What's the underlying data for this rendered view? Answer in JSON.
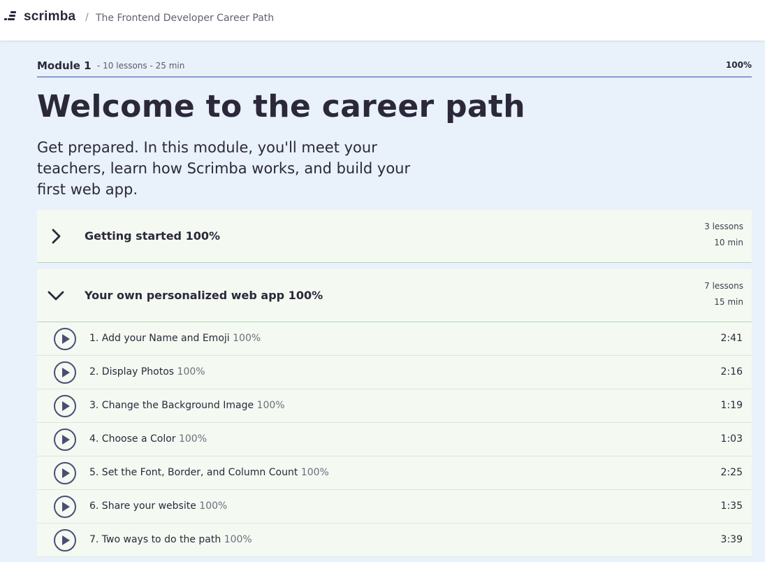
{
  "header": {
    "logo_text": "scrimba",
    "breadcrumb_separator": "/",
    "breadcrumb": "The Frontend Developer Career Path"
  },
  "module": {
    "title": "Module 1",
    "meta": "- 10 lessons - 25 min",
    "progress": "100%"
  },
  "hero": {
    "title": "Welcome to the career path",
    "description": "Get prepared. In this module, you'll meet your teachers, learn how Scrimba works, and build your first web app."
  },
  "sections": [
    {
      "title": "Getting started 100%",
      "lessons": "3 lessons",
      "duration": "10 min",
      "expanded": false,
      "icon": "chevron-right-icon"
    },
    {
      "title": "Your own personalized web app 100%",
      "lessons": "7 lessons",
      "duration": "15 min",
      "expanded": true,
      "icon": "chevron-down-icon"
    }
  ],
  "lessons": [
    {
      "title": "1. Add your Name and Emoji",
      "progress": "100%",
      "duration": "2:41"
    },
    {
      "title": "2. Display Photos",
      "progress": "100%",
      "duration": "2:16"
    },
    {
      "title": "3. Change the Background Image",
      "progress": "100%",
      "duration": "1:19"
    },
    {
      "title": "4. Choose a Color",
      "progress": "100%",
      "duration": "1:03"
    },
    {
      "title": "5. Set the Font, Border, and Column Count",
      "progress": "100%",
      "duration": "2:25"
    },
    {
      "title": "6. Share your website",
      "progress": "100%",
      "duration": "1:35"
    },
    {
      "title": "7. Two ways to do the path",
      "progress": "100%",
      "duration": "3:39"
    }
  ],
  "colors": {
    "page_bg": "#e9f1fb",
    "section_bg": "#f4f9f2",
    "text": "#2b283a",
    "accent_line": "#8c9ad4",
    "play_icon": "#4a4e74"
  }
}
